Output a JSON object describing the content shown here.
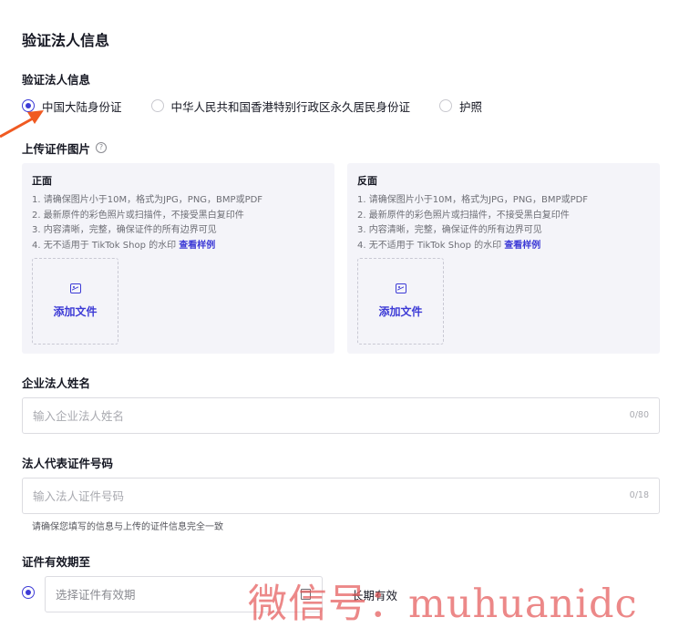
{
  "page_title": "验证法人信息",
  "id_type": {
    "label": "验证法人信息",
    "options": [
      {
        "label": "中国大陆身份证",
        "checked": true
      },
      {
        "label": "中华人民共和国香港特别行政区永久居民身份证",
        "checked": false
      },
      {
        "label": "护照",
        "checked": false
      }
    ]
  },
  "upload": {
    "label": "上传证件图片",
    "help_icon": "question-circle-icon",
    "cards": [
      {
        "title": "正面",
        "lines": [
          "1. 请确保图片小于10M，格式为JPG，PNG，BMP或PDF",
          "2. 最新原件的彩色照片或扫描件，不接受黑白复印件",
          "3. 内容清晰，完整，确保证件的所有边界可见",
          "4. 无不适用于 TikTok Shop 的水印"
        ],
        "link": "查看样例",
        "drop_text": "添加文件"
      },
      {
        "title": "反面",
        "lines": [
          "1. 请确保图片小于10M，格式为JPG，PNG，BMP或PDF",
          "2. 最新原件的彩色照片或扫描件，不接受黑白复印件",
          "3. 内容清晰，完整，确保证件的所有边界可见",
          "4. 无不适用于 TikTok Shop 的水印"
        ],
        "link": "查看样例",
        "drop_text": "添加文件"
      }
    ]
  },
  "legal_name": {
    "label": "企业法人姓名",
    "placeholder": "输入企业法人姓名",
    "counter": "0/80"
  },
  "id_number": {
    "label": "法人代表证件号码",
    "placeholder": "输入法人证件号码",
    "counter": "0/18",
    "hint": "请确保您填写的信息与上传的证件信息完全一致"
  },
  "validity": {
    "label": "证件有效期至",
    "placeholder": "选择证件有效期",
    "long_term": "长期有效"
  },
  "watermark": "微信号：muhuanidc",
  "colors": {
    "accent": "#3d3bd6",
    "arrow": "#f05a22",
    "card_bg": "#f4f4f9"
  }
}
